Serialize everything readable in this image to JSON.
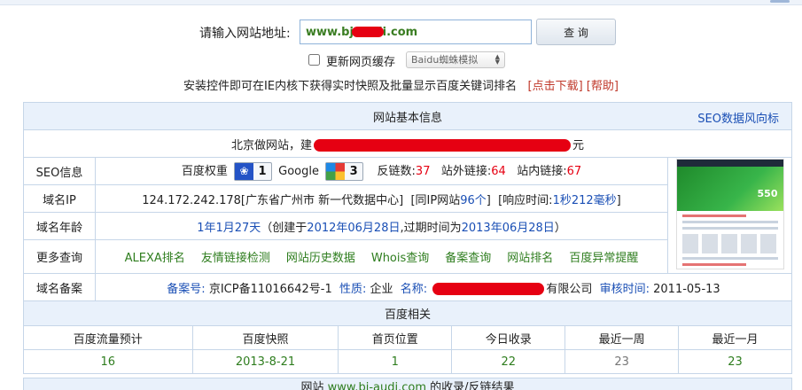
{
  "query": {
    "label": "请输入网站地址:",
    "url_value": "www.bj-audi.com",
    "button": "查 询",
    "cache_label": "更新网页缓存",
    "spider_select": "Baidu蜘蛛模拟"
  },
  "notice": {
    "text": "安装控件即可在IE内核下获得实时快照及批量显示百度关键词排名",
    "download": "点击下载",
    "help": "帮助",
    "bracket_open": "[",
    "bracket_close": "]"
  },
  "info": {
    "title": "网站基本信息",
    "seo_link": "SEO数据风向标",
    "desc_prefix": "北京做网站，建",
    "desc_suffix": "元",
    "seo": {
      "label": "SEO信息",
      "baidu_weight_label": "百度权重",
      "baidu_weight": "1",
      "google_label": "Google",
      "google_pr": "3",
      "backlinks_label": "反链数:",
      "backlinks": "37",
      "outlinks_label": "站外链接:",
      "outlinks": "64",
      "inlinks_label": "站内链接:",
      "inlinks": "67"
    },
    "ip": {
      "label": "域名IP",
      "text": "124.172.242.178[广东省广州市 新一代数据中心]",
      "same_ip_prefix": "[同IP网站",
      "same_ip_count": "96个",
      "same_ip_suffix": "]",
      "resp_prefix": "[响应时间:",
      "resp_time": "1秒212毫秒",
      "resp_suffix": "]"
    },
    "age": {
      "label": "域名年龄",
      "age": "1年1月27天",
      "created_prefix": "（创建于",
      "created": "2012年06月28日",
      "expire_prefix": ",过期时间为",
      "expire": "2013年06月28日",
      "close": "）"
    },
    "more": {
      "label": "更多查询",
      "links": [
        "ALEXA排名",
        "友情链接检测",
        "网站历史数据",
        "Whois查询",
        "备案查询",
        "网站排名",
        "百度异常提醒"
      ]
    },
    "icp": {
      "label": "域名备案",
      "icp_label": "备案号:",
      "icp": "京ICP备11016642号-1",
      "nature_label": "性质:",
      "nature": "企业",
      "name_label": "名称:",
      "name_suffix": "有限公司",
      "audit_label": "审核时间:",
      "audit": "2011-05-13"
    },
    "thumb_price": "550"
  },
  "baidu": {
    "title": "百度相关",
    "headers": [
      "百度流量预计",
      "百度快照",
      "首页位置",
      "今日收录",
      "最近一周",
      "最近一月"
    ],
    "values": [
      "16",
      "2013-8-21",
      "1",
      "22",
      "23",
      "23"
    ]
  },
  "footer": {
    "prefix": "网站",
    "site": "www.bj-audi.com",
    "suffix": "的收录/反链结果"
  },
  "colors": {
    "accent_blue": "#1a4fb5",
    "value_red": "#e60012",
    "value_green": "#2e7d1e",
    "header_bg": "#e9f1fb"
  }
}
